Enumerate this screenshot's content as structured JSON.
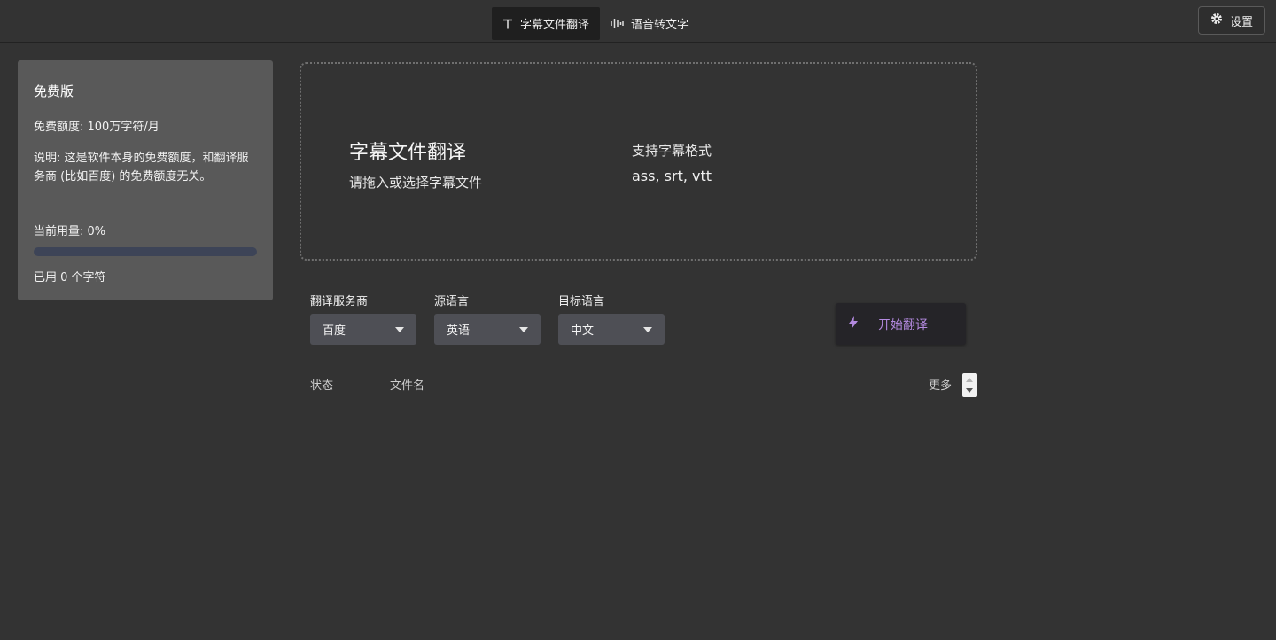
{
  "header": {
    "tabs": [
      {
        "label": "字幕文件翻译",
        "icon": "text-icon",
        "active": true
      },
      {
        "label": "语音转文字",
        "icon": "waveform-icon",
        "active": false
      }
    ],
    "settings_label": "设置"
  },
  "plan": {
    "title": "免费版",
    "quota": "免费额度: 100万字符/月",
    "note": "说明: 这是软件本身的免费额度，和翻译服务商 (比如百度) 的免费额度无关。",
    "usage_label": "当前用量: 0%",
    "usage_fraction": 0,
    "used_text": "已用 0 个字符",
    "progress_color": "#3d4457"
  },
  "dropzone": {
    "title": "字幕文件翻译",
    "subtitle": "请拖入或选择字幕文件",
    "formats_label": "支持字幕格式",
    "formats": "ass, srt, vtt"
  },
  "form": {
    "provider": {
      "label": "翻译服务商",
      "value": "百度"
    },
    "source": {
      "label": "源语言",
      "value": "英语"
    },
    "target": {
      "label": "目标语言",
      "value": "中文"
    },
    "start_label": "开始翻译",
    "start_icon": "lightning-icon",
    "accent": "#b48ae0"
  },
  "table": {
    "columns": [
      "状态",
      "文件名",
      "更多"
    ]
  }
}
